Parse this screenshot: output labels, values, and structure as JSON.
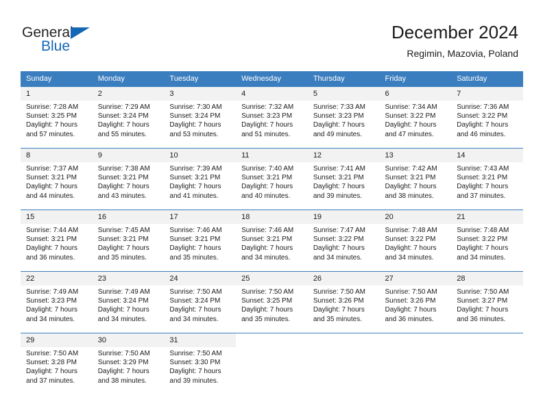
{
  "logo": {
    "text_dark": "General",
    "text_blue": "Blue",
    "brand_dark_color": "#231f20",
    "brand_blue_color": "#1567b6"
  },
  "header": {
    "title": "December 2024",
    "subtitle": "Regimin, Mazovia, Poland"
  },
  "calendar": {
    "header_bg_color": "#3b7ebf",
    "daynum_bg_color": "#f2f2f2",
    "weekday_headers": [
      "Sunday",
      "Monday",
      "Tuesday",
      "Wednesday",
      "Thursday",
      "Friday",
      "Saturday"
    ],
    "weeks": [
      [
        {
          "day": "1",
          "sunrise": "Sunrise: 7:28 AM",
          "sunset": "Sunset: 3:25 PM",
          "daylight_line1": "Daylight: 7 hours",
          "daylight_line2": "and 57 minutes."
        },
        {
          "day": "2",
          "sunrise": "Sunrise: 7:29 AM",
          "sunset": "Sunset: 3:24 PM",
          "daylight_line1": "Daylight: 7 hours",
          "daylight_line2": "and 55 minutes."
        },
        {
          "day": "3",
          "sunrise": "Sunrise: 7:30 AM",
          "sunset": "Sunset: 3:24 PM",
          "daylight_line1": "Daylight: 7 hours",
          "daylight_line2": "and 53 minutes."
        },
        {
          "day": "4",
          "sunrise": "Sunrise: 7:32 AM",
          "sunset": "Sunset: 3:23 PM",
          "daylight_line1": "Daylight: 7 hours",
          "daylight_line2": "and 51 minutes."
        },
        {
          "day": "5",
          "sunrise": "Sunrise: 7:33 AM",
          "sunset": "Sunset: 3:23 PM",
          "daylight_line1": "Daylight: 7 hours",
          "daylight_line2": "and 49 minutes."
        },
        {
          "day": "6",
          "sunrise": "Sunrise: 7:34 AM",
          "sunset": "Sunset: 3:22 PM",
          "daylight_line1": "Daylight: 7 hours",
          "daylight_line2": "and 47 minutes."
        },
        {
          "day": "7",
          "sunrise": "Sunrise: 7:36 AM",
          "sunset": "Sunset: 3:22 PM",
          "daylight_line1": "Daylight: 7 hours",
          "daylight_line2": "and 46 minutes."
        }
      ],
      [
        {
          "day": "8",
          "sunrise": "Sunrise: 7:37 AM",
          "sunset": "Sunset: 3:21 PM",
          "daylight_line1": "Daylight: 7 hours",
          "daylight_line2": "and 44 minutes."
        },
        {
          "day": "9",
          "sunrise": "Sunrise: 7:38 AM",
          "sunset": "Sunset: 3:21 PM",
          "daylight_line1": "Daylight: 7 hours",
          "daylight_line2": "and 43 minutes."
        },
        {
          "day": "10",
          "sunrise": "Sunrise: 7:39 AM",
          "sunset": "Sunset: 3:21 PM",
          "daylight_line1": "Daylight: 7 hours",
          "daylight_line2": "and 41 minutes."
        },
        {
          "day": "11",
          "sunrise": "Sunrise: 7:40 AM",
          "sunset": "Sunset: 3:21 PM",
          "daylight_line1": "Daylight: 7 hours",
          "daylight_line2": "and 40 minutes."
        },
        {
          "day": "12",
          "sunrise": "Sunrise: 7:41 AM",
          "sunset": "Sunset: 3:21 PM",
          "daylight_line1": "Daylight: 7 hours",
          "daylight_line2": "and 39 minutes."
        },
        {
          "day": "13",
          "sunrise": "Sunrise: 7:42 AM",
          "sunset": "Sunset: 3:21 PM",
          "daylight_line1": "Daylight: 7 hours",
          "daylight_line2": "and 38 minutes."
        },
        {
          "day": "14",
          "sunrise": "Sunrise: 7:43 AM",
          "sunset": "Sunset: 3:21 PM",
          "daylight_line1": "Daylight: 7 hours",
          "daylight_line2": "and 37 minutes."
        }
      ],
      [
        {
          "day": "15",
          "sunrise": "Sunrise: 7:44 AM",
          "sunset": "Sunset: 3:21 PM",
          "daylight_line1": "Daylight: 7 hours",
          "daylight_line2": "and 36 minutes."
        },
        {
          "day": "16",
          "sunrise": "Sunrise: 7:45 AM",
          "sunset": "Sunset: 3:21 PM",
          "daylight_line1": "Daylight: 7 hours",
          "daylight_line2": "and 35 minutes."
        },
        {
          "day": "17",
          "sunrise": "Sunrise: 7:46 AM",
          "sunset": "Sunset: 3:21 PM",
          "daylight_line1": "Daylight: 7 hours",
          "daylight_line2": "and 35 minutes."
        },
        {
          "day": "18",
          "sunrise": "Sunrise: 7:46 AM",
          "sunset": "Sunset: 3:21 PM",
          "daylight_line1": "Daylight: 7 hours",
          "daylight_line2": "and 34 minutes."
        },
        {
          "day": "19",
          "sunrise": "Sunrise: 7:47 AM",
          "sunset": "Sunset: 3:22 PM",
          "daylight_line1": "Daylight: 7 hours",
          "daylight_line2": "and 34 minutes."
        },
        {
          "day": "20",
          "sunrise": "Sunrise: 7:48 AM",
          "sunset": "Sunset: 3:22 PM",
          "daylight_line1": "Daylight: 7 hours",
          "daylight_line2": "and 34 minutes."
        },
        {
          "day": "21",
          "sunrise": "Sunrise: 7:48 AM",
          "sunset": "Sunset: 3:22 PM",
          "daylight_line1": "Daylight: 7 hours",
          "daylight_line2": "and 34 minutes."
        }
      ],
      [
        {
          "day": "22",
          "sunrise": "Sunrise: 7:49 AM",
          "sunset": "Sunset: 3:23 PM",
          "daylight_line1": "Daylight: 7 hours",
          "daylight_line2": "and 34 minutes."
        },
        {
          "day": "23",
          "sunrise": "Sunrise: 7:49 AM",
          "sunset": "Sunset: 3:24 PM",
          "daylight_line1": "Daylight: 7 hours",
          "daylight_line2": "and 34 minutes."
        },
        {
          "day": "24",
          "sunrise": "Sunrise: 7:50 AM",
          "sunset": "Sunset: 3:24 PM",
          "daylight_line1": "Daylight: 7 hours",
          "daylight_line2": "and 34 minutes."
        },
        {
          "day": "25",
          "sunrise": "Sunrise: 7:50 AM",
          "sunset": "Sunset: 3:25 PM",
          "daylight_line1": "Daylight: 7 hours",
          "daylight_line2": "and 35 minutes."
        },
        {
          "day": "26",
          "sunrise": "Sunrise: 7:50 AM",
          "sunset": "Sunset: 3:26 PM",
          "daylight_line1": "Daylight: 7 hours",
          "daylight_line2": "and 35 minutes."
        },
        {
          "day": "27",
          "sunrise": "Sunrise: 7:50 AM",
          "sunset": "Sunset: 3:26 PM",
          "daylight_line1": "Daylight: 7 hours",
          "daylight_line2": "and 36 minutes."
        },
        {
          "day": "28",
          "sunrise": "Sunrise: 7:50 AM",
          "sunset": "Sunset: 3:27 PM",
          "daylight_line1": "Daylight: 7 hours",
          "daylight_line2": "and 36 minutes."
        }
      ],
      [
        {
          "day": "29",
          "sunrise": "Sunrise: 7:50 AM",
          "sunset": "Sunset: 3:28 PM",
          "daylight_line1": "Daylight: 7 hours",
          "daylight_line2": "and 37 minutes."
        },
        {
          "day": "30",
          "sunrise": "Sunrise: 7:50 AM",
          "sunset": "Sunset: 3:29 PM",
          "daylight_line1": "Daylight: 7 hours",
          "daylight_line2": "and 38 minutes."
        },
        {
          "day": "31",
          "sunrise": "Sunrise: 7:50 AM",
          "sunset": "Sunset: 3:30 PM",
          "daylight_line1": "Daylight: 7 hours",
          "daylight_line2": "and 39 minutes."
        },
        {
          "day": "",
          "sunrise": "",
          "sunset": "",
          "daylight_line1": "",
          "daylight_line2": ""
        },
        {
          "day": "",
          "sunrise": "",
          "sunset": "",
          "daylight_line1": "",
          "daylight_line2": ""
        },
        {
          "day": "",
          "sunrise": "",
          "sunset": "",
          "daylight_line1": "",
          "daylight_line2": ""
        },
        {
          "day": "",
          "sunrise": "",
          "sunset": "",
          "daylight_line1": "",
          "daylight_line2": ""
        }
      ]
    ]
  }
}
